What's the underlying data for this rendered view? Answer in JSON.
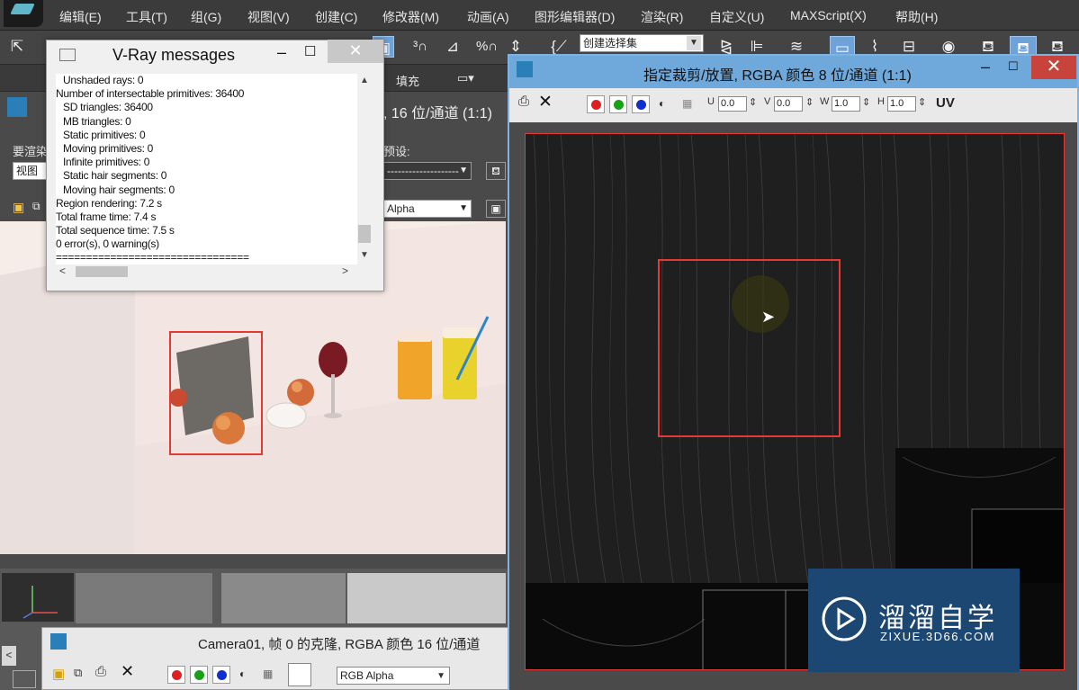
{
  "menubar": {
    "items": [
      "编辑(E)",
      "工具(T)",
      "组(G)",
      "视图(V)",
      "创建(C)",
      "修改器(M)",
      "动画(A)",
      "图形编辑器(D)",
      "渲染(R)",
      "自定义(U)",
      "MAXScript(X)",
      "帮助(H)"
    ]
  },
  "toolbar": {
    "view_label": "视图",
    "named_selection_sets": "创建选择集"
  },
  "ribbon": {
    "fill_label": "填充"
  },
  "frame_window": {
    "title_partial": ", 16 位/通道 (1:1)",
    "render_label_partial": "要渲染",
    "view_value": "视图",
    "preset_label_partial": "预设:",
    "preset_value": "--------------------",
    "channel_value": "Alpha"
  },
  "vray_messages": {
    "title": "V-Ray messages",
    "lines": [
      "Unshaded rays: 0",
      "Number of intersectable primitives: 36400",
      "SD triangles: 36400",
      "MB triangles: 0",
      "Static primitives: 0",
      "Moving primitives: 0",
      "Infinite primitives: 0",
      "Static hair segments: 0",
      "Moving hair segments: 0",
      "Region rendering: 7.2 s",
      "Total frame time: 7.4 s",
      "Total sequence time: 7.5 s",
      "0 error(s), 0 warning(s)",
      "================================"
    ],
    "indented": [
      true,
      false,
      true,
      true,
      true,
      true,
      true,
      true,
      true,
      false,
      false,
      false,
      false,
      false
    ]
  },
  "crop_window": {
    "title": "指定裁剪/放置, RGBA 颜色 8 位/通道 (1:1)",
    "u_label": "U",
    "u_value": "0.0",
    "v_label": "V",
    "v_value": "0.0",
    "w_label": "W",
    "w_value": "1.0",
    "h_label": "H",
    "h_value": "1.0",
    "uv_label": "UV"
  },
  "clone_window": {
    "title": "Camera01, 帧 0 的克隆, RGBA 颜色 16 位/通道",
    "channel_value": "RGB Alpha"
  },
  "watermark": {
    "brand": "溜溜自学",
    "url": "ZIXUE.3D66.COM"
  },
  "colors": {
    "red_channel": "#e02020",
    "green_channel": "#18a018",
    "blue_channel": "#1030d0",
    "selection_rect": "#e53935",
    "title_active": "#6fa8db",
    "close_red": "#c7433b"
  }
}
